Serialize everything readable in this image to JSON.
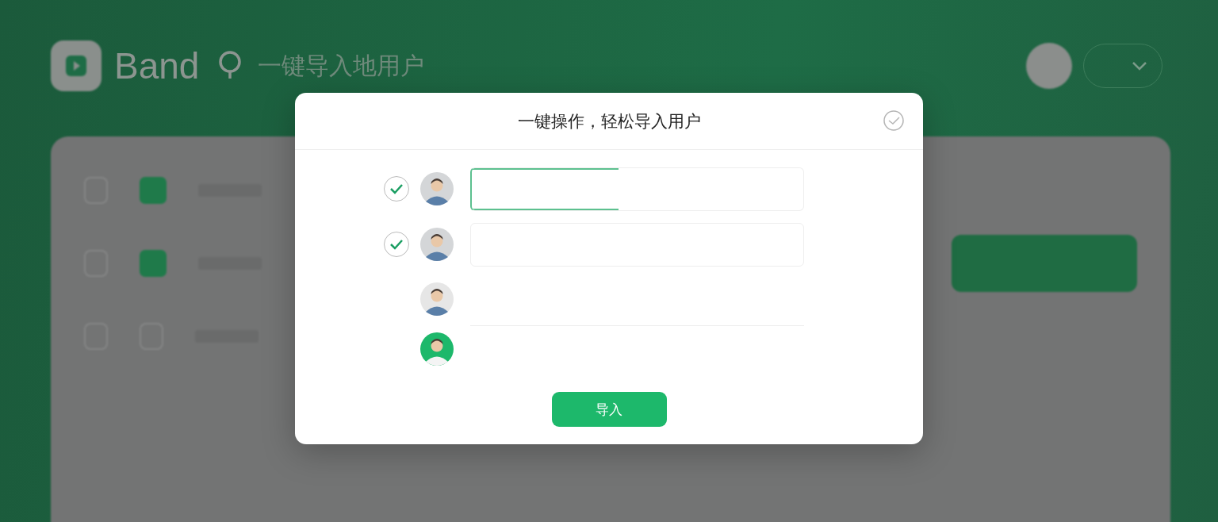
{
  "app_header": {
    "brand": "Band",
    "subtitle": "一键导入地用户"
  },
  "dialog": {
    "title": "一键操作，轻松导入用户",
    "rows": [
      {
        "kind": "field",
        "checked": true,
        "color": "#d4d6d8",
        "focused": true
      },
      {
        "kind": "field",
        "checked": true,
        "color": "#d4d6d8",
        "focused": false
      },
      {
        "kind": "line",
        "checked": false,
        "color": "#e6e6e6"
      },
      {
        "kind": "plain",
        "checked": false,
        "color": "#1db86b"
      }
    ],
    "button": "导入"
  }
}
